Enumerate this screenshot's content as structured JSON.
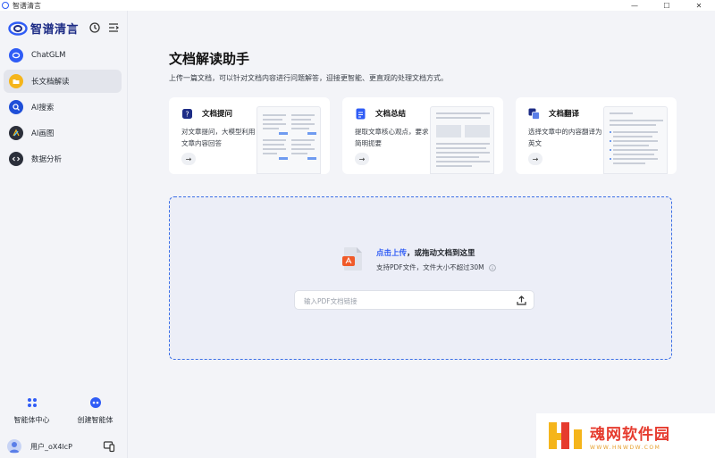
{
  "window": {
    "title": "智谱清言",
    "controls": [
      "—",
      "☐",
      "✕"
    ]
  },
  "sidebar": {
    "brand": "智谱清言",
    "items": [
      {
        "label": "ChatGLM",
        "icon": "chatglm-icon",
        "active": false
      },
      {
        "label": "长文档解读",
        "icon": "folder-icon",
        "active": true
      },
      {
        "label": "AI搜索",
        "icon": "ai-search-icon",
        "active": false
      },
      {
        "label": "AI画图",
        "icon": "ai-draw-icon",
        "active": false
      },
      {
        "label": "数据分析",
        "icon": "code-icon",
        "active": false
      }
    ],
    "bottom": {
      "agent_center": "智能体中心",
      "create_agent": "创建智能体"
    },
    "user": {
      "name": "用户_oX4lcP"
    }
  },
  "main": {
    "title": "文档解读助手",
    "subtitle": "上传一篇文档，可以针对文档内容进行问题解答，迎接更智能、更直观的处理文档方式。",
    "cards": [
      {
        "title": "文档提问",
        "desc": "对文章提问，大模型利用文章内容回答",
        "arrow": "→"
      },
      {
        "title": "文档总结",
        "desc": "提取文章核心观点，要求简明扼要",
        "arrow": "→"
      },
      {
        "title": "文档翻译",
        "desc": "选择文章中的内容翻译为英文",
        "arrow": "→"
      }
    ],
    "upload": {
      "link": "点击上传",
      "rest": "，或拖动文档到这里",
      "hint": "支持PDF文件，文件大小不超过30M",
      "url_placeholder": "输入PDF文档链接"
    }
  },
  "watermark": {
    "title": "魂网软件园",
    "url": "WWW.HNWDW.COM"
  },
  "colors": {
    "accent": "#2f5cf6",
    "brand": "#1d2c86",
    "dash": "#3b6fe6",
    "watermark": "#e63b2e"
  }
}
